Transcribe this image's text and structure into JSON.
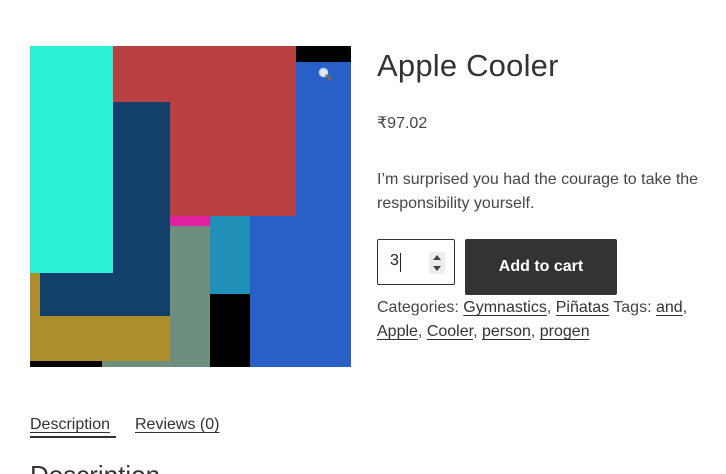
{
  "product": {
    "title": "Apple Cooler",
    "price": "₹97.02",
    "short_description": "I’m surprised you had the courage to take the responsibility yourself.",
    "quantity": "3",
    "add_to_cart_label": "Add to cart",
    "categories_label": "Categories:",
    "categories": [
      "Gymnastics",
      "Piñatas"
    ],
    "tags_label": "Tags:",
    "tags": [
      "and",
      "Apple",
      "Cooler",
      "person",
      "progen"
    ]
  },
  "gallery": {
    "zoom_icon": "magnifier-icon"
  },
  "tabs": {
    "description_label": "Description",
    "reviews_label": "Reviews (0)",
    "panel_heading": "Description"
  },
  "colors": {
    "button_bg": "#333333",
    "text": "#43454b",
    "image_blue": "#2860c8",
    "image_cyan": "#2af0d8",
    "image_red": "#b84040",
    "image_navy": "#12406a",
    "image_mustard": "#ac8e2c",
    "image_sage": "#6e8e7e",
    "image_teal": "#2090b8",
    "image_magenta": "#e020a0"
  }
}
